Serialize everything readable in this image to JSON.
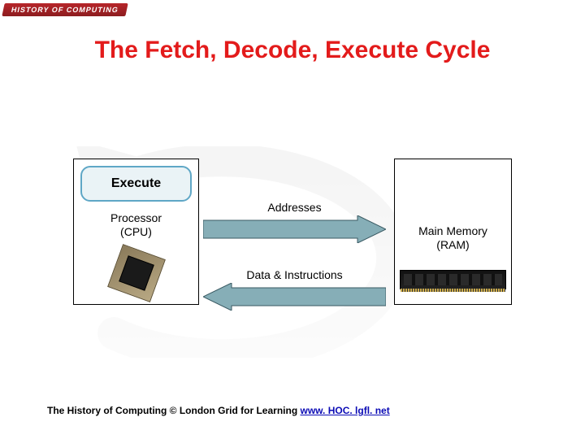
{
  "logo_text": "HISTORY OF COMPUTING",
  "title": "The Fetch, Decode, Execute Cycle",
  "execute_label": "Execute",
  "cpu_label_line1": "Processor",
  "cpu_label_line2": "(CPU)",
  "ram_label_line1": "Main Memory",
  "ram_label_line2": "(RAM)",
  "addresses_label": "Addresses",
  "data_label": "Data & Instructions",
  "footer_text": "The History of Computing © London Grid for Learning   ",
  "footer_link_text": "www. HOC. lgfl. net",
  "colors": {
    "title_red": "#e31b1b",
    "arrow_teal": "#86aeb7",
    "pill_bg": "#eaf3f6",
    "pill_border": "#5fa7c6"
  }
}
